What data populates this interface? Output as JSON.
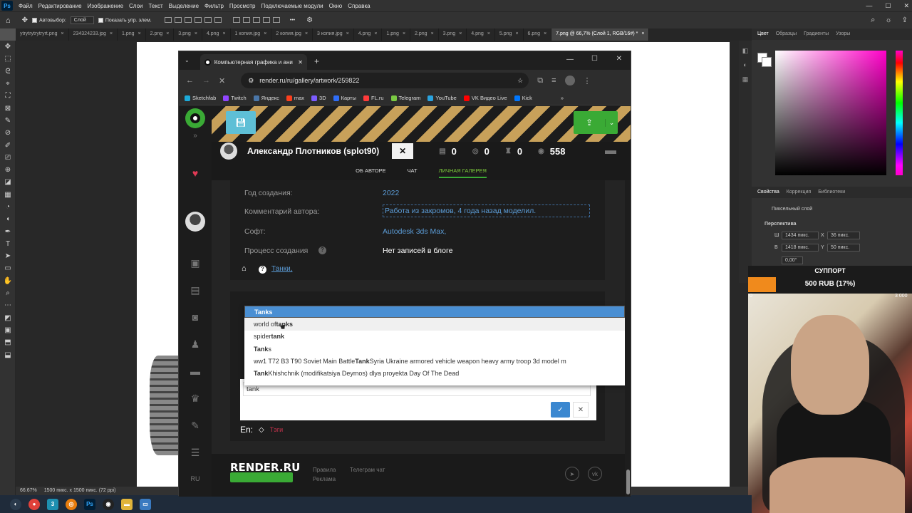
{
  "ps": {
    "menu": [
      "Файл",
      "Редактирование",
      "Изображение",
      "Слои",
      "Текст",
      "Выделение",
      "Фильтр",
      "Просмотр",
      "Подключаемые модули",
      "Окно",
      "Справка"
    ],
    "options": {
      "autoselect": "Автовыбор:",
      "layer": "Слой",
      "show_controls": "Показать упр. элем."
    },
    "tabs": [
      "ytrytrytrytryrt.png",
      "234324233.jpg",
      "1.png",
      "2.png",
      "3.png",
      "4.png",
      "1 копия.jpg",
      "2 копия.jpg",
      "3 копия.jpg",
      "4.png",
      "1.png",
      "2.png",
      "3.png",
      "4.png",
      "5.png",
      "6.png",
      "7.png @ 66,7% (Слой 1, RGB/16#) *"
    ],
    "status": {
      "zoom": "66.67%",
      "info": "1500 пикс. x 1500 пикс. (72 ppi)"
    },
    "right": {
      "tabs_top": [
        "Цвет",
        "Образцы",
        "Градиенты",
        "Узоры"
      ],
      "tabs_props": [
        "Свойства",
        "Коррекция",
        "Библиотеки"
      ],
      "pixel_layer": "Пиксельный слой",
      "perspective": "Перспектива",
      "w_label": "Ш",
      "w_val": "1434 пикс.",
      "x_label": "X",
      "x_val": "36 пикс.",
      "h_label": "В",
      "h_val": "1418 пикс.",
      "y_label": "Y",
      "y_val": "50 пикс.",
      "angle": "0,00°"
    }
  },
  "support": {
    "title": "СУППОРТ",
    "amount": "500 RUB (17%)",
    "min": "0",
    "max": "3 000",
    "progress": 0.17
  },
  "browser": {
    "tab_title": "Компьютерная графика и ани",
    "url": "render.ru/ru/gallery/artwork/259822",
    "bookmarks": [
      "Sketchfab",
      "Twitch",
      "Яндекс",
      "max",
      "3D",
      "Карты",
      "FL.ru",
      "Telegram",
      "YouTube",
      "VK Видео Live",
      "Kick"
    ]
  },
  "page": {
    "author": "Александр Плотников (splot90)",
    "stats": [
      "0",
      "0",
      "0",
      "558"
    ],
    "nav": [
      "ОБ АВТОРЕ",
      "ЧАТ",
      "ЛИЧНАЯ ГАЛЕРЕЯ"
    ],
    "info": {
      "year_label": "Год создания:",
      "year": "2022",
      "comment_label": "Комментарий автора:",
      "comment": "Работа из закромов, 4 года назад моделил.",
      "soft_label": "Софт:",
      "soft": "Autodesk 3ds Max,",
      "process_label": "Процесс создания",
      "process": "Нет записей в блоге",
      "tag": "Танки,"
    },
    "dropdown": [
      {
        "pre": "",
        "bold": "Tanks",
        "post": ""
      },
      {
        "pre": "world of ",
        "bold": "tanks",
        "post": ""
      },
      {
        "pre": "spider ",
        "bold": "tank",
        "post": ""
      },
      {
        "pre": "",
        "bold": "Tank",
        "post": "s"
      },
      {
        "pre": "ww1 T72 B3 T90 Soviet Main Battle ",
        "bold": "Tank",
        "post": " Syria Ukraine armored vehicle weapon heavy army troop 3d model m"
      },
      {
        "pre": "",
        "bold": "Tank",
        "post": " Khishchnik (modifikatsiya Deymos) dlya proyekta Day Of The Dead"
      }
    ],
    "tag_input": "tank",
    "en_label": "En:",
    "en_tags": "Тэги",
    "footer": {
      "logo": "RENDER.RU",
      "rules": "Правила",
      "ads": "Реклама",
      "tg": "Телеграм чат",
      "lang": "RU"
    }
  }
}
